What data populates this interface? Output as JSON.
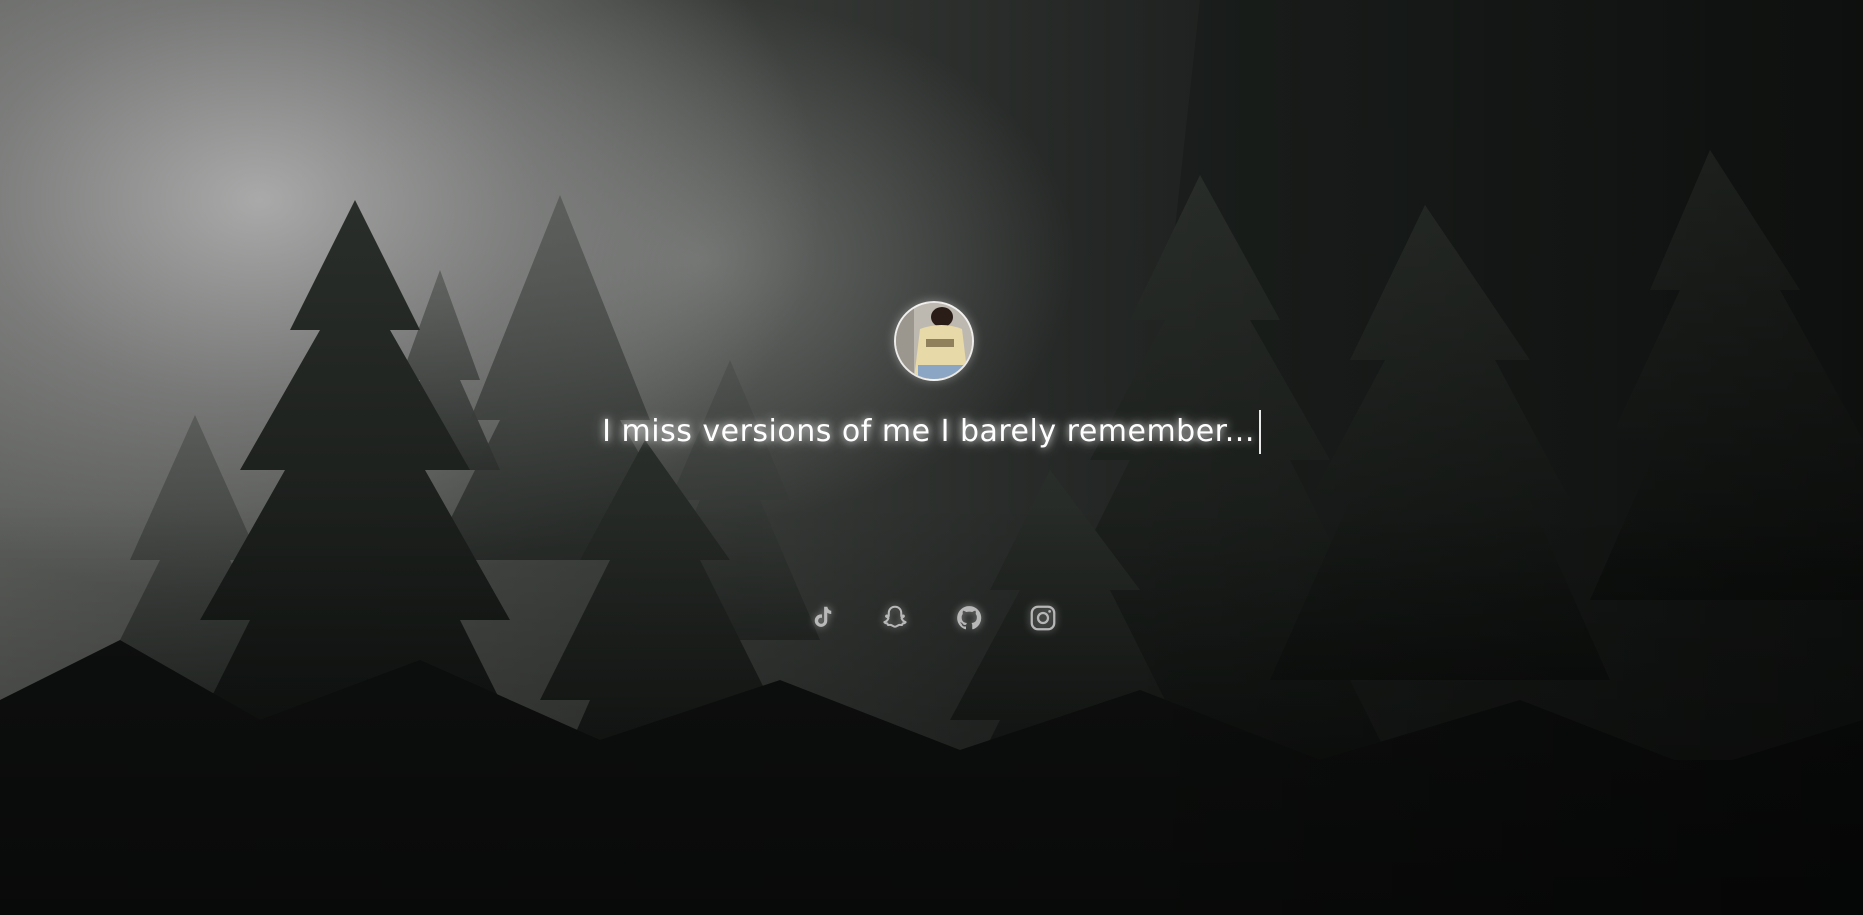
{
  "profile": {
    "avatar_icon": "profile-photo",
    "avatar_shirt_text": "RHUDE"
  },
  "tagline": {
    "text": "I miss versions of me I barely remember..."
  },
  "socials": [
    {
      "name": "tiktok",
      "icon": "tiktok-icon"
    },
    {
      "name": "snapchat",
      "icon": "snapchat-icon"
    },
    {
      "name": "github",
      "icon": "github-icon"
    },
    {
      "name": "instagram",
      "icon": "instagram-icon"
    }
  ],
  "colors": {
    "text": "#ffffff",
    "icon": "#d8d8d8"
  }
}
